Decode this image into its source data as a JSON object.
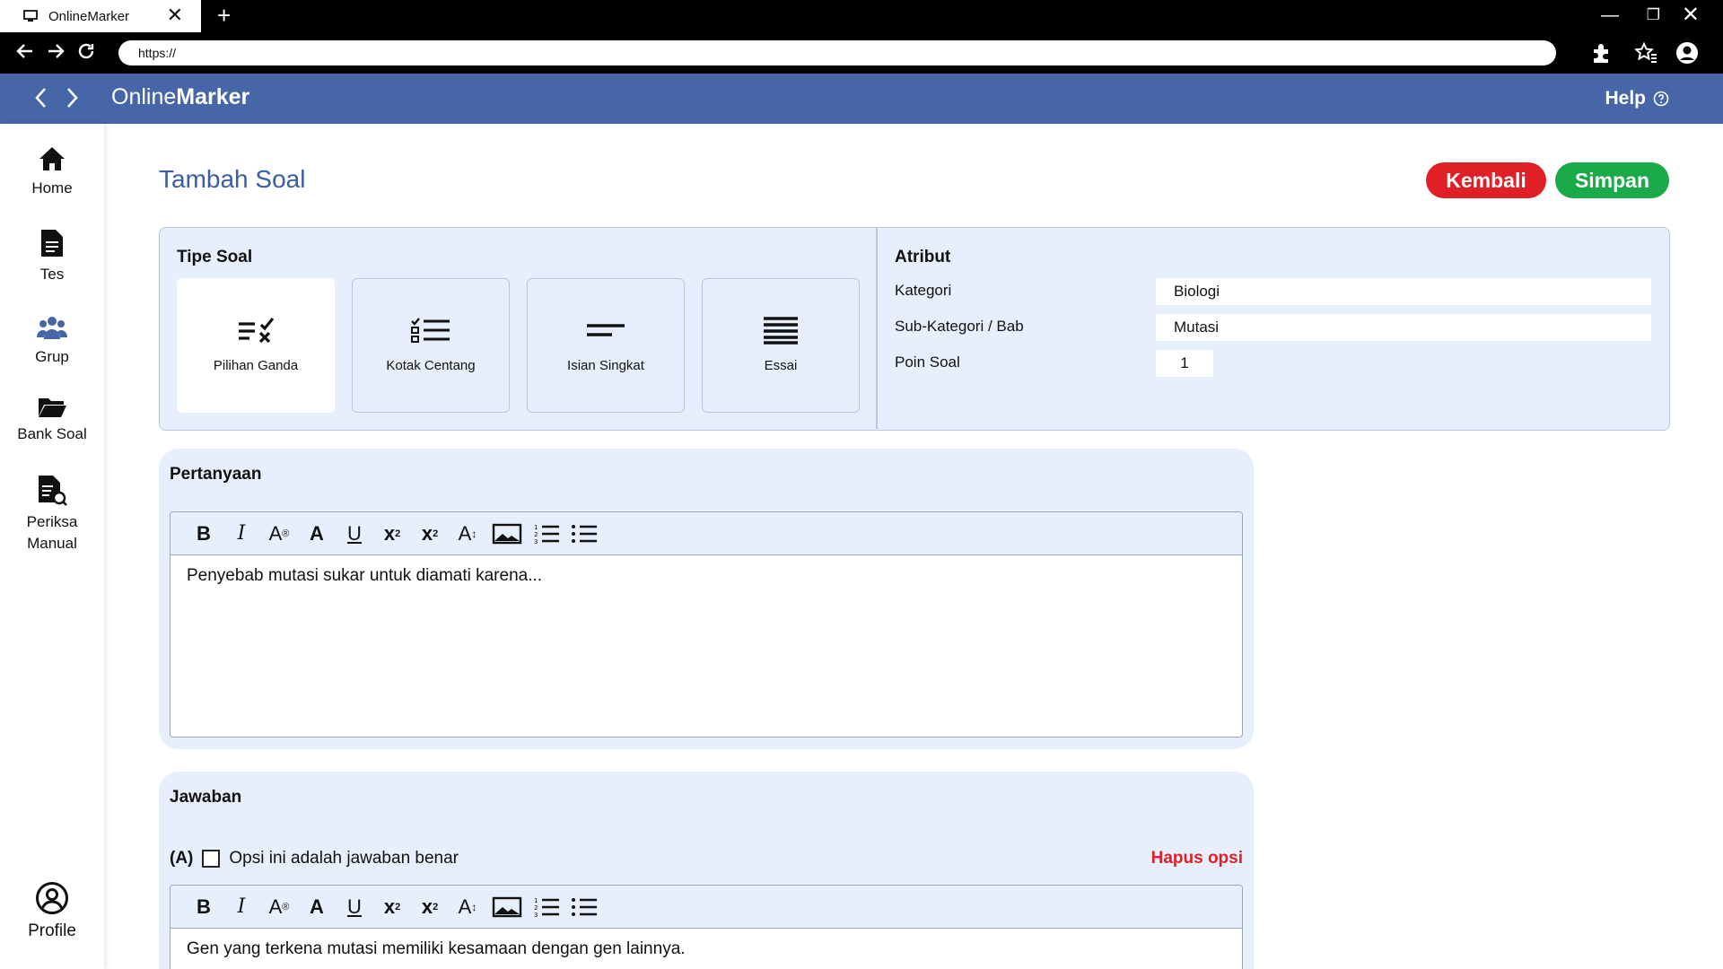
{
  "browser": {
    "tab_title": "OnlineMarker",
    "url": "https://"
  },
  "header": {
    "brand_light": "Online",
    "brand_bold": "Marker",
    "help": "Help"
  },
  "sidebar": {
    "items": [
      {
        "label": "Home",
        "icon": "home-icon"
      },
      {
        "label": "Tes",
        "icon": "document-icon"
      },
      {
        "label": "Grup",
        "icon": "group-icon"
      },
      {
        "label": "Bank Soal",
        "icon": "folder-icon"
      },
      {
        "label": "Periksa Manual",
        "icon": "document-search-icon"
      }
    ],
    "profile": "Profile"
  },
  "page": {
    "title": "Tambah Soal",
    "back_button": "Kembali",
    "save_button": "Simpan"
  },
  "tipe_soal": {
    "title": "Tipe Soal",
    "options": [
      {
        "label": "Pilihan Ganda",
        "selected": true
      },
      {
        "label": "Kotak Centang",
        "selected": false
      },
      {
        "label": "Isian Singkat",
        "selected": false
      },
      {
        "label": "Essai",
        "selected": false
      }
    ]
  },
  "atribut": {
    "title": "Atribut",
    "kategori_label": "Kategori",
    "kategori_value": "Biologi",
    "subkategori_label": "Sub-Kategori / Bab",
    "subkategori_value": "Mutasi",
    "poin_label": "Poin Soal",
    "poin_value": "1"
  },
  "pertanyaan": {
    "title": "Pertanyaan",
    "text": "Penyebab mutasi sukar untuk diamati karena..."
  },
  "jawaban": {
    "title": "Jawaban",
    "option_letter": "(A)",
    "correct_label": "Opsi ini adalah jawaban benar",
    "correct_checked": false,
    "delete_label": "Hapus opsi",
    "text": "Gen yang terkena mutasi memiliki kesamaan dengan gen lainnya."
  },
  "colors": {
    "header_blue": "#4766a8",
    "panel_bg": "#e8effc",
    "danger": "#e01f26",
    "success": "#1aaa4a"
  }
}
